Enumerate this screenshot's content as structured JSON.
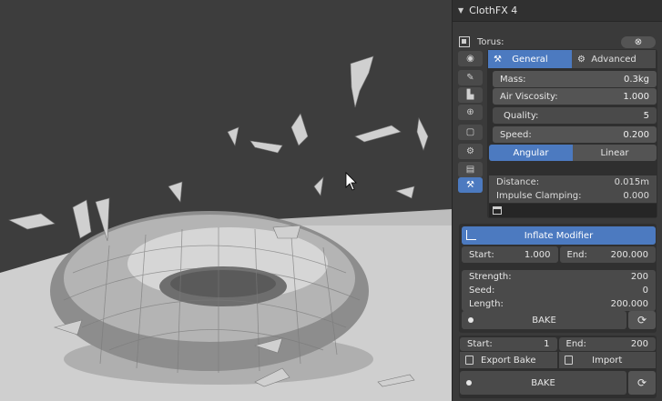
{
  "panel": {
    "title": "ClothFX 4",
    "object_label": "Torus:",
    "clear_icon": "close-icon"
  },
  "vertical_tabs": [
    {
      "icon": "eye-icon"
    },
    {
      "icon": "pencil-icon"
    },
    {
      "icon": "stamp-icon"
    },
    {
      "icon": "globe-icon"
    },
    {
      "icon": "page-icon"
    },
    {
      "icon": "gear-icon"
    },
    {
      "icon": "document-icon"
    },
    {
      "icon": "wrench-icon"
    }
  ],
  "tabs": {
    "general": "General",
    "advanced": "Advanced"
  },
  "fields": {
    "mass_label": "Mass:",
    "mass_value": "0.3kg",
    "air_label": "Air Viscosity:",
    "air_value": "1.000",
    "quality_label": "Quality:",
    "quality_value": "5",
    "speed_label": "Speed:",
    "speed_value": "0.200"
  },
  "segment": {
    "angular": "Angular",
    "linear": "Linear"
  },
  "distance": {
    "label": "Distance:",
    "value": "0.015m"
  },
  "impulse": {
    "label": "Impulse Clamping:",
    "value": "0.000"
  },
  "inflate": {
    "title": "Inflate Modifier",
    "start_label": "Start:",
    "start_value": "1.000",
    "end_label": "End:",
    "end_value": "200.000",
    "strength_label": "Strength:",
    "strength_value": "200",
    "seed_label": "Seed:",
    "seed_value": "0",
    "length_label": "Length:",
    "length_value": "200.000",
    "bake_label": "BAKE"
  },
  "bottom": {
    "start_label": "Start:",
    "start_value": "1",
    "end_label": "End:",
    "end_value": "200",
    "export_label": "Export Bake",
    "import_label": "Import",
    "bake_label": "BAKE"
  }
}
